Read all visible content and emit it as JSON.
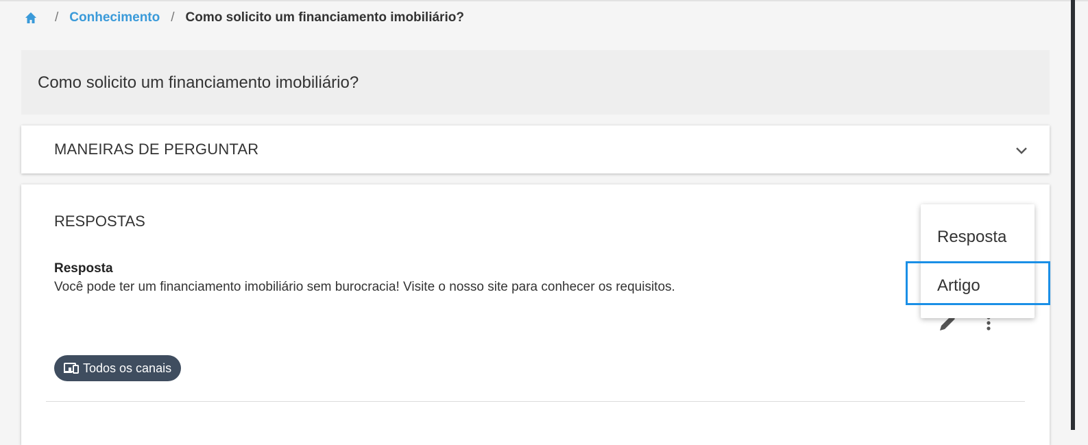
{
  "breadcrumb": {
    "home_icon": "home-icon",
    "separator": "/",
    "link": "Conhecimento",
    "current": "Como solicito um financiamento imobiliário?"
  },
  "question": {
    "title": "Como solicito um financiamento imobiliário?"
  },
  "ways_to_ask": {
    "label": "MANEIRAS DE PERGUNTAR",
    "expand_icon": "chevron-down-icon"
  },
  "answers": {
    "label": "RESPOSTAS",
    "item": {
      "title": "Resposta",
      "body": "Você pode ter um financiamento imobiliário sem burocracia! Visite o nosso site para conhecer os requisitos.",
      "channel_chip": "Todos os canais",
      "channel_icon": "devices-icon"
    },
    "actions": {
      "edit_icon": "pencil-icon",
      "more_icon": "more-vertical-icon"
    }
  },
  "add_menu": {
    "items": [
      "Resposta",
      "Artigo"
    ],
    "highlighted": "Artigo"
  },
  "colors": {
    "link": "#3a9ad9",
    "chip_bg": "#3f4d5f",
    "highlight": "#1a8fe6"
  }
}
